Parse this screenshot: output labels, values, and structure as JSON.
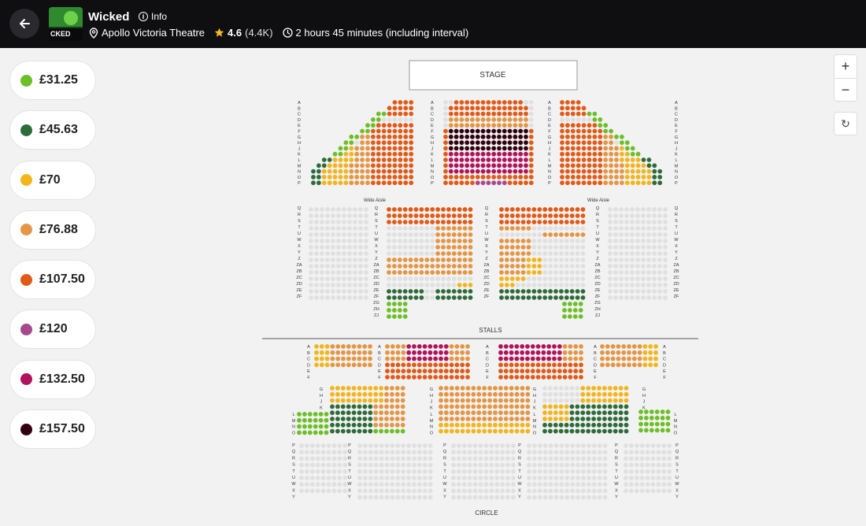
{
  "header": {
    "title": "Wicked",
    "info_label": "Info",
    "venue": "Apollo Victoria Theatre",
    "rating": "4.6",
    "review_count": "(4.4K)",
    "duration": "2 hours 45 minutes (including interval)",
    "thumb_text": "CKED"
  },
  "prices": [
    {
      "label": "£31.25",
      "color": "#6cbf27"
    },
    {
      "label": "£45.63",
      "color": "#2e6b3a"
    },
    {
      "label": "£70",
      "color": "#f2b51c"
    },
    {
      "label": "£76.88",
      "color": "#e39645"
    },
    {
      "label": "£107.50",
      "color": "#e15a18"
    },
    {
      "label": "£120",
      "color": "#a64a8e"
    },
    {
      "label": "£132.50",
      "color": "#b2125b"
    },
    {
      "label": "£157.50",
      "color": "#300010"
    }
  ],
  "map": {
    "stage_label": "STAGE",
    "aisle_label": "Wide Aisle",
    "stalls_label": "STALLS",
    "circle_label": "CIRCLE",
    "stalls_rows_upper": [
      "A",
      "B",
      "C",
      "D",
      "E",
      "F",
      "G",
      "H",
      "J",
      "K",
      "L",
      "M",
      "N",
      "O",
      "P"
    ],
    "stalls_rows_lower": [
      "Q",
      "R",
      "S",
      "T",
      "U",
      "W",
      "X",
      "Y",
      "Z",
      "ZA",
      "ZB",
      "ZC",
      "ZD",
      "ZE",
      "ZF"
    ],
    "stalls_rows_extra": [
      "ZG",
      "ZH",
      "ZJ"
    ],
    "circle_rows_front": [
      "A",
      "B",
      "C",
      "D",
      "E",
      "F"
    ],
    "circle_rows_mid": [
      "G",
      "H",
      "J",
      "K",
      "L",
      "M",
      "N",
      "O"
    ],
    "circle_rows_back": [
      "P",
      "Q",
      "R",
      "S",
      "T",
      "U",
      "W",
      "X",
      "Y"
    ]
  },
  "controls": {
    "zoom_in": "+",
    "zoom_out": "−",
    "reset": "↻"
  }
}
